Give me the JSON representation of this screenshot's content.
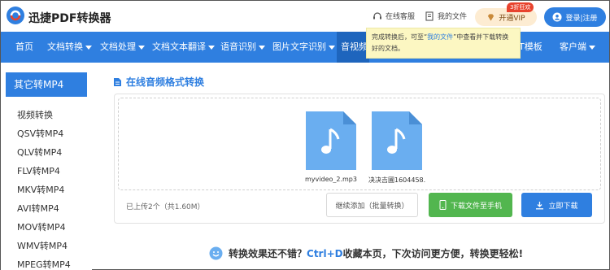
{
  "header": {
    "brand": "迅捷PDF转换器",
    "service_link": "在线客服",
    "files_link": "我的文件",
    "vip_label": "开通VIP",
    "vip_badge": "3折狂欢",
    "login_label": "登录|注册"
  },
  "nav": {
    "items": [
      {
        "label": "首页"
      },
      {
        "label": "文档转换"
      },
      {
        "label": "文档处理"
      },
      {
        "label": "文档文本翻译"
      },
      {
        "label": "语音识别"
      },
      {
        "label": "图片文字识别"
      },
      {
        "label": "音视频"
      },
      {
        "label": "T模板"
      },
      {
        "label": "客户端"
      }
    ]
  },
  "tooltip": {
    "part1": "完成转换后，可至“",
    "highlight": "我的文件",
    "part2": "”中查看并下载转换好的文档。"
  },
  "sidebar": {
    "title": "其它转MP4",
    "items": [
      {
        "label": "视频转换"
      },
      {
        "label": "QSV转MP4"
      },
      {
        "label": "QLV转MP4"
      },
      {
        "label": "FLV转MP4"
      },
      {
        "label": "MKV转MP4"
      },
      {
        "label": "AVI转MP4"
      },
      {
        "label": "MOV转MP4"
      },
      {
        "label": "WMV转MP4"
      },
      {
        "label": "MPEG转MP4"
      }
    ]
  },
  "main": {
    "section_title": "在线音频格式转换",
    "files": [
      {
        "name": "myvideo_2.mp3"
      },
      {
        "name": "决决吉圃1604458..."
      }
    ],
    "upload_info": "已上传2个（共1.60M）",
    "add_button": "继续添加（批量转换）",
    "phone_button": "下载文件至手机",
    "download_button": "立即下载"
  },
  "footer": {
    "msg_part1": "转换效果还不错？",
    "msg_hl": "Ctrl+D",
    "msg_part2": "收藏本页，下次访问更方便，转换更轻松!"
  },
  "colors": {
    "primary": "#2f7fe0",
    "nav_active": "#1e65bd",
    "green": "#52b64f",
    "file_icon": "#6aaef0",
    "vip_bg": "#fdecd2",
    "tooltip_bg": "#fcf7c2"
  }
}
